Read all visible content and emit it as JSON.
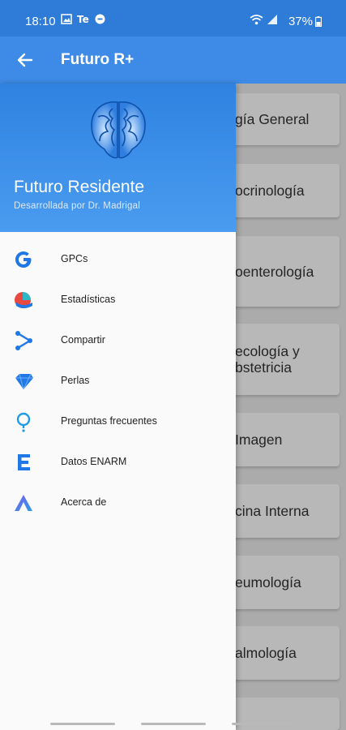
{
  "status_bar": {
    "time": "18:10",
    "battery": "37%"
  },
  "app_bar": {
    "title": "Futuro R+"
  },
  "drawer": {
    "title": "Futuro Residente",
    "subtitle": "Desarrollada por Dr. Madrigal",
    "items": [
      {
        "label": "GPCs",
        "icon": "google-g-icon"
      },
      {
        "label": "Estadísticas",
        "icon": "stats-icon"
      },
      {
        "label": "Compartir",
        "icon": "share-icon"
      },
      {
        "label": "Perlas",
        "icon": "gem-icon"
      },
      {
        "label": "Preguntas frecuentes",
        "icon": "question-icon"
      },
      {
        "label": "Datos ENARM",
        "icon": "e-letter-icon"
      },
      {
        "label": "Acerca de",
        "icon": "about-icon"
      }
    ]
  },
  "categories": [
    {
      "line1": "gía General",
      "line2": ""
    },
    {
      "line1": "ocrinología",
      "line2": ""
    },
    {
      "line1": "oenterología",
      "line2": ""
    },
    {
      "line1": "ecología y",
      "line2": "bstetricia"
    },
    {
      "line1": "Imagen",
      "line2": ""
    },
    {
      "line1": "cina Interna",
      "line2": ""
    },
    {
      "line1": "eumología",
      "line2": ""
    },
    {
      "line1": "almología",
      "line2": ""
    }
  ],
  "colors": {
    "primary": "#3d8be6",
    "status": "#2e7bd8",
    "header_gradient_end": "#4a9cf0"
  }
}
